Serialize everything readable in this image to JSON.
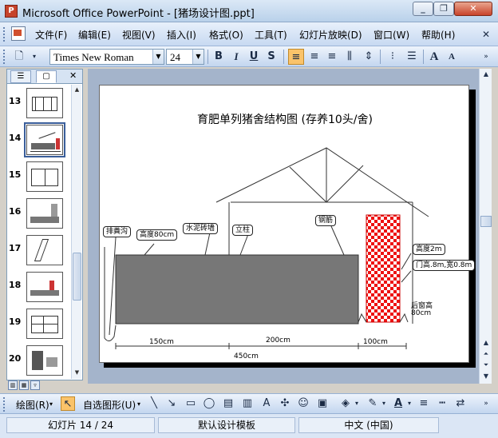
{
  "window": {
    "app_icon": "P",
    "title": "Microsoft Office PowerPoint - [猪场设计图.ppt]",
    "minimize_icon": "_",
    "restore_icon": "❐",
    "close_icon": "✕"
  },
  "menu": {
    "items": [
      "文件(F)",
      "编辑(E)",
      "视图(V)",
      "插入(I)",
      "格式(O)",
      "工具(T)",
      "幻灯片放映(D)",
      "窗口(W)",
      "帮助(H)"
    ],
    "close_icon": "✕"
  },
  "toolbar": {
    "font_name": "Times New Roman",
    "font_size": "24",
    "bold": "B",
    "italic": "I",
    "underline": "U",
    "shadow": "S",
    "grow_font": "A",
    "shrink_font": "A"
  },
  "pane": {
    "outline_tab_icon": "outline-icon",
    "slides_tab_icon": "slides-icon",
    "close_icon": "✕",
    "slides": [
      {
        "num": "13"
      },
      {
        "num": "14"
      },
      {
        "num": "15"
      },
      {
        "num": "16"
      },
      {
        "num": "17"
      },
      {
        "num": "18"
      },
      {
        "num": "19"
      },
      {
        "num": "20"
      }
    ]
  },
  "slide": {
    "title": "育肥单列猪舍结构图 (存养10头/舍)",
    "labels": {
      "drain": "排粪沟",
      "height80": "高度80cm",
      "cement_wall": "水泥砖墙",
      "column": "立柱",
      "steel_bar": "钢筋",
      "height2m": "高度2m",
      "door": "门高.8m,宽0.8m",
      "window_line1": "后窗高",
      "window_line2": "80cm"
    },
    "dims": {
      "d150": "150cm",
      "d200": "200cm",
      "d100": "100cm",
      "d450": "450cm"
    }
  },
  "drawbar": {
    "draw_label": "绘图(R)",
    "autoshape_label": "自选图形(U)"
  },
  "status": {
    "slide_info": "幻灯片 14 / 24",
    "template": "默认设计模板",
    "language": "中文 (中国)"
  }
}
